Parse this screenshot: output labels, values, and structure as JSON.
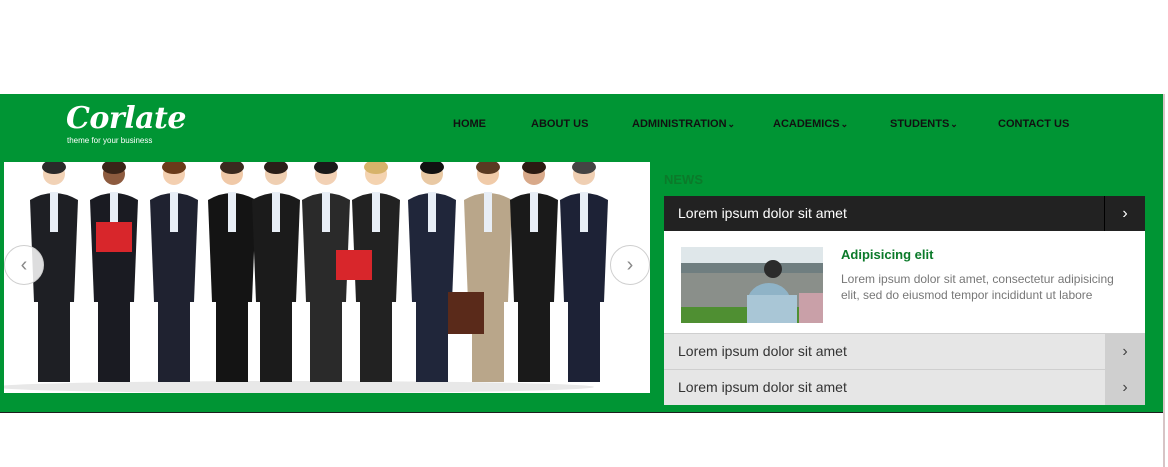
{
  "brand": {
    "name": "Corlate",
    "tagline": "theme for your business"
  },
  "nav": [
    {
      "label": "HOME",
      "dropdown": false
    },
    {
      "label": "ABOUT US",
      "dropdown": false
    },
    {
      "label": "ADMINISTRATION",
      "dropdown": true
    },
    {
      "label": "ACADEMICS",
      "dropdown": true
    },
    {
      "label": "STUDENTS",
      "dropdown": true
    },
    {
      "label": "CONTACT US",
      "dropdown": false
    }
  ],
  "slider": {
    "prev_icon": "chevron-left-icon",
    "next_icon": "chevron-right-icon"
  },
  "news": {
    "heading": "NEWS",
    "items": [
      {
        "title": "Lorem ipsum dolor sit amet",
        "active": true
      },
      {
        "title": "Lorem ipsum dolor sit amet",
        "active": false
      },
      {
        "title": "Lorem ipsum dolor sit amet",
        "active": false
      }
    ],
    "featured": {
      "title": "Adipisicing elit",
      "text": "Lorem ipsum dolor sit amet, consectetur adipisicing elit, sed do eiusmod tempor incididunt ut labore"
    }
  },
  "colors": {
    "header_bg": "#009534",
    "accent_green": "#0b7a2a",
    "active_row": "#222222",
    "row_bg": "#e6e6e6"
  }
}
